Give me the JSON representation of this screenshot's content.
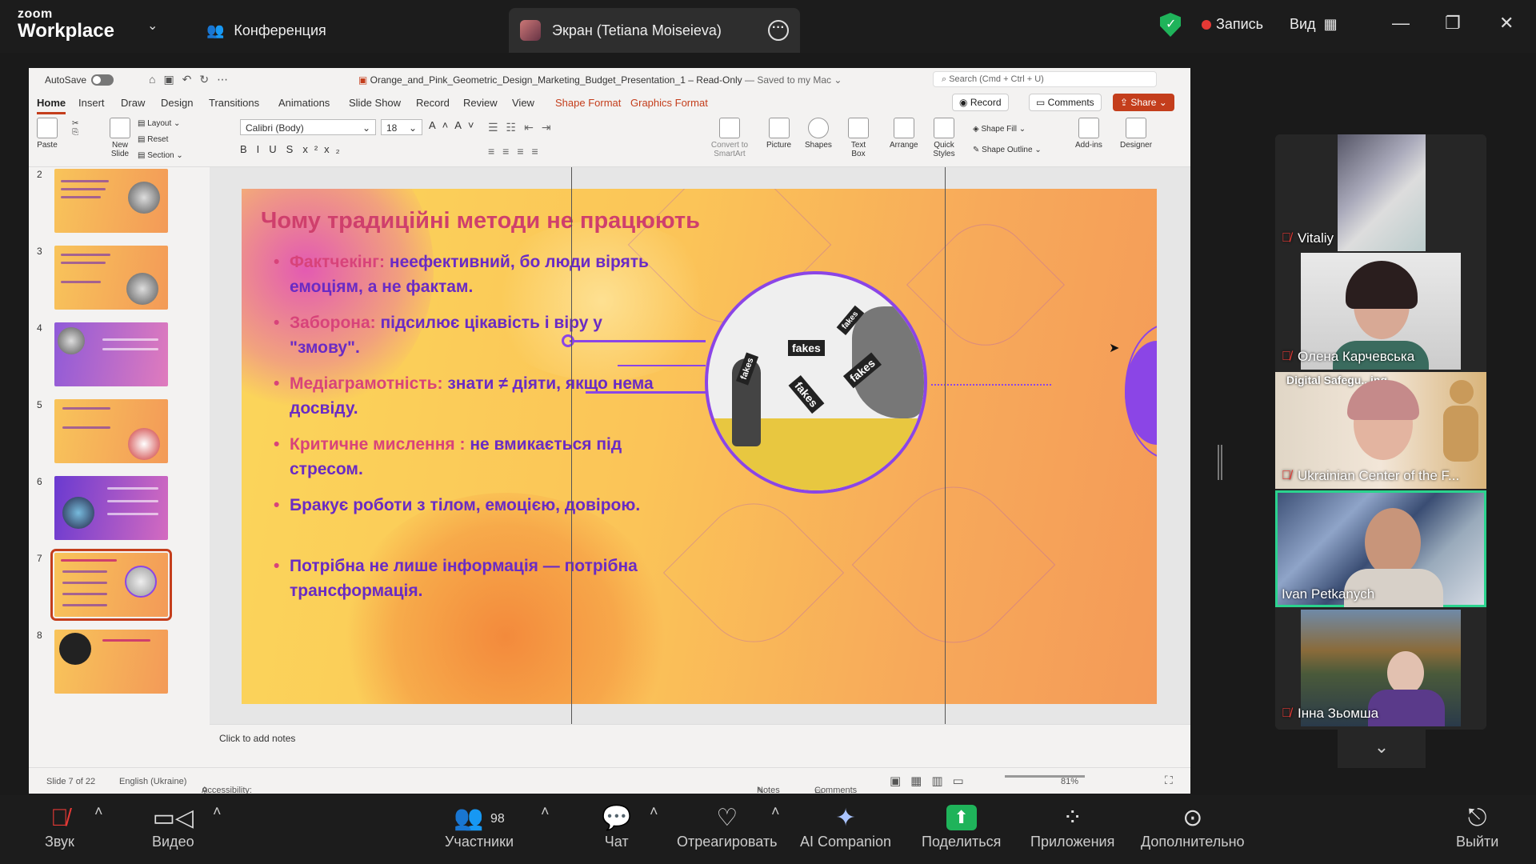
{
  "zoom": {
    "logo_small": "zoom",
    "logo_big": "Workplace",
    "tab_conference": "Конференция",
    "tab_screen": "Экран (Tetiana Moiseieva)",
    "record_label": "Запись",
    "view_label": "Вид"
  },
  "ppt": {
    "autosave": "AutoSave",
    "doc_name": "Orange_and_Pink_Geometric_Design_Marketing_Budget_Presentation_1",
    "doc_status": "Read-Only",
    "doc_saved": "— Saved to my Mac ⌄",
    "search_placeholder": "Search (Cmd + Ctrl + U)",
    "tabs": [
      "Home",
      "Insert",
      "Draw",
      "Design",
      "Transitions",
      "Animations",
      "Slide Show",
      "Record",
      "Review",
      "View"
    ],
    "ctx_tabs": [
      "Shape Format",
      "Graphics Format"
    ],
    "record_btn": "Record",
    "comments_btn": "Comments",
    "share_btn": "Share",
    "ribbon": {
      "paste": "Paste",
      "new_slide": "New Slide",
      "layout": "Layout",
      "reset": "Reset",
      "section": "Section",
      "font": "Calibri (Body)",
      "size": "18",
      "convert": "Convert to SmartArt",
      "picture": "Picture",
      "shapes": "Shapes",
      "text_box": "Text Box",
      "arrange": "Arrange",
      "quick_styles": "Quick Styles",
      "shape_fill": "Shape Fill",
      "shape_outline": "Shape Outline",
      "addins": "Add-ins",
      "designer": "Designer"
    },
    "thumb_numbers": [
      "2",
      "3",
      "4",
      "5",
      "6",
      "7",
      "8"
    ],
    "slide": {
      "title": "Чому традиційні методи не працюють",
      "bullets": [
        {
          "head": "Фактчекінг:",
          "rest": "неефективний, бо люди вірять емоціям, а не фактам."
        },
        {
          "head": "Заборона:",
          "rest": "підсилює цікавість і віру у \"змову\"."
        },
        {
          "head": "Медіаграмотність:",
          "rest": "знати ≠ діяти, якщо нема досвіду."
        },
        {
          "head": "Критичне мислення :",
          "rest": "не вмикається під стресом."
        },
        {
          "head": "",
          "rest": "Бракує роботи з тілом, емоцією, довірою."
        },
        {
          "head": "",
          "rest": "Потрібна не лише інформація — потрібна трансформація."
        }
      ],
      "img_tags": [
        "fakes",
        "fakes",
        "fakes",
        "fakes",
        "fakes"
      ]
    },
    "notes_placeholder": "Click to add notes",
    "status": {
      "slide": "Slide 7 of 22",
      "lang": "English (Ukraine)",
      "accessibility": "Accessibility: Investigate",
      "notes": "Notes",
      "comments": "Comments",
      "zoom": "81%"
    }
  },
  "participants": [
    {
      "name": "Vitaliy",
      "muted": true
    },
    {
      "name": "Олена Карчевська",
      "muted": true
    },
    {
      "name": "Ukrainian Center of the F...",
      "muted": true,
      "overlay": "Digital Safegu...ing"
    },
    {
      "name": "Ivan Petkanych",
      "muted": false
    },
    {
      "name": "Інна Зьомша",
      "muted": true
    }
  ],
  "toolbar": {
    "audio": "Звук",
    "video": "Видео",
    "participants": "Участники",
    "participants_count": "98",
    "chat": "Чат",
    "react": "Отреагировать",
    "ai": "AI Companion",
    "share": "Поделиться",
    "apps": "Приложения",
    "more": "Дополнительно",
    "leave": "Выйти"
  }
}
